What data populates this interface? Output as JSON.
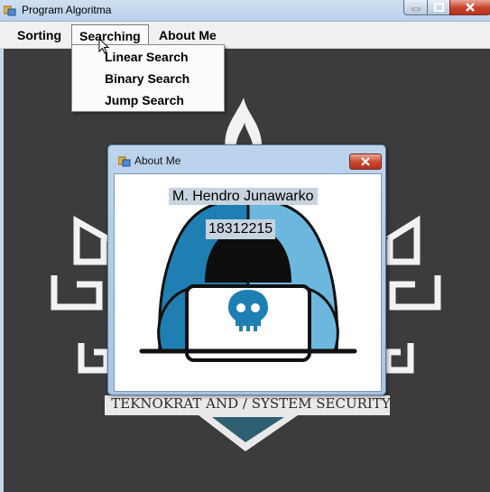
{
  "window": {
    "title": "Program Algoritma",
    "icon": "app-icon"
  },
  "menu": {
    "items": [
      {
        "label": "Sorting"
      },
      {
        "label": "Searching"
      },
      {
        "label": "About Me"
      }
    ],
    "open_menu": "Searching",
    "searching_items": [
      {
        "label": "Linear Search"
      },
      {
        "label": "Binary Search"
      },
      {
        "label": "Jump Search"
      }
    ]
  },
  "background": {
    "logo_text": "TEKNOKRAT AND / SYSTEM SECURITY"
  },
  "dialog": {
    "title": "About Me",
    "name": "M. Hendro Junawarko",
    "id_number": "18312215"
  },
  "colors": {
    "hoodie": "#1f7fb3",
    "hoodie_light": "#6cb7dd",
    "client_bg": "#3c3c3c"
  }
}
